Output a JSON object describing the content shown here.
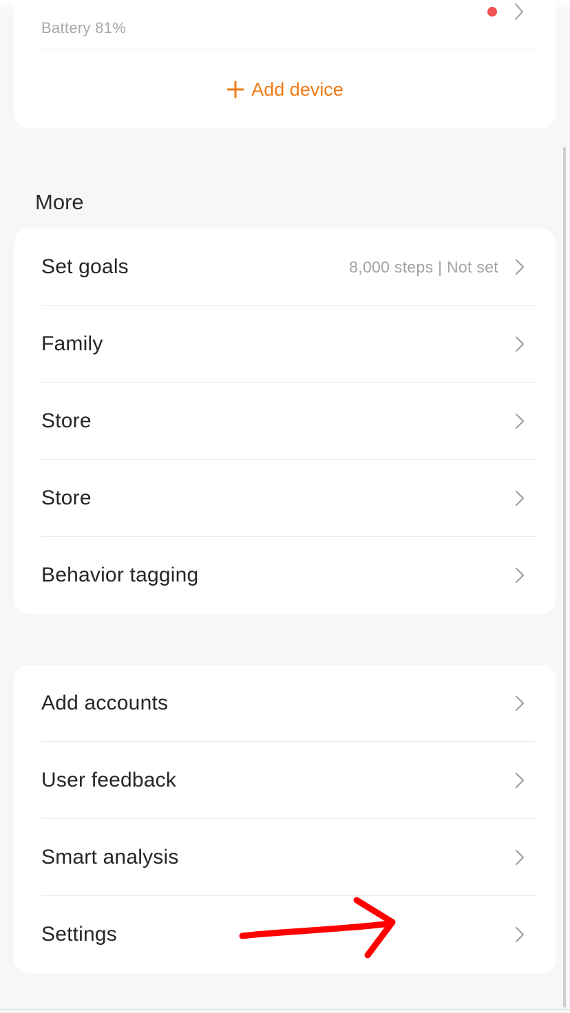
{
  "device": {
    "battery": "Battery 81%",
    "add_device": "Add device",
    "unread_color": "#f25252"
  },
  "more": {
    "title": "More",
    "items": [
      {
        "label": "Set goals",
        "value": "8,000 steps | Not set"
      },
      {
        "label": "Family"
      },
      {
        "label": "Store"
      },
      {
        "label": "Store"
      },
      {
        "label": "Behavior tagging"
      }
    ]
  },
  "account": {
    "items": [
      {
        "label": "Add accounts"
      },
      {
        "label": "User feedback"
      },
      {
        "label": "Smart analysis"
      },
      {
        "label": "Settings"
      }
    ]
  },
  "colors": {
    "accent": "#f07a14",
    "annotation": "#ff0000",
    "background": "#f7f7f7",
    "card": "#ffffff"
  },
  "icons": {
    "row_trailing": "chevron-right-icon",
    "add": "plus-icon",
    "notification": "red-dot-badge"
  }
}
